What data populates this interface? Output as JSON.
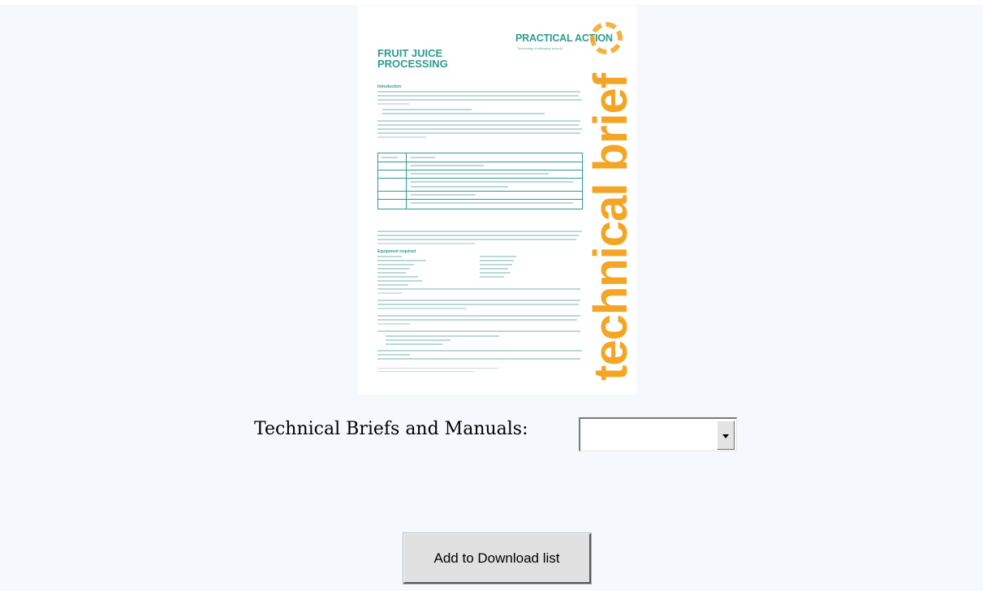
{
  "document": {
    "logo_text": "PRACTICAL ACTION",
    "logo_tagline": "Technology challenging poverty",
    "title": "FRUIT JUICE PROCESSING",
    "vertical_text": "technical brief",
    "section_introduction": "Introduction",
    "section_equipment": "Equipment required"
  },
  "selector": {
    "label": "Technical Briefs and Manuals:",
    "value": ""
  },
  "actions": {
    "add_button": "Add to Download list"
  },
  "colors": {
    "brand_teal": "#2e9b8f",
    "brand_orange": "#f4a523",
    "background": "#f5f9fd"
  }
}
